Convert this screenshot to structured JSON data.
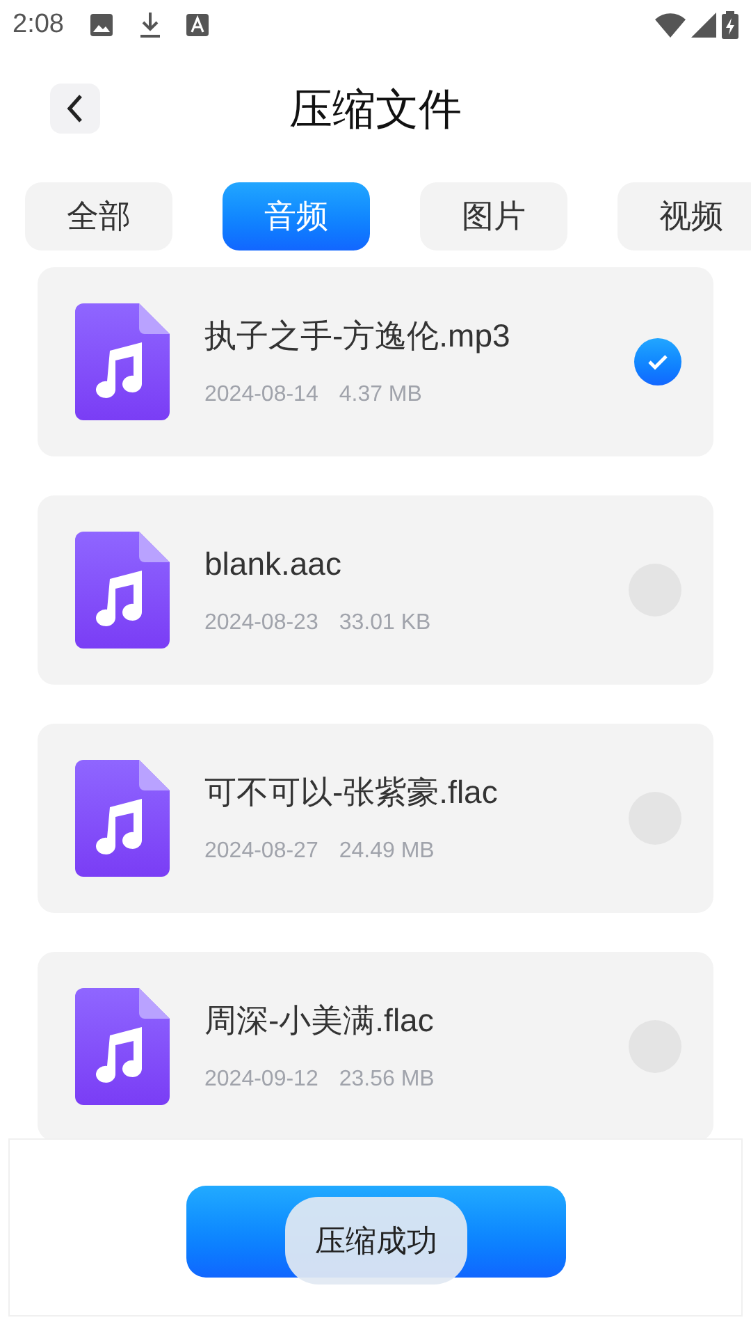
{
  "status_bar": {
    "time": "2:08"
  },
  "header": {
    "title": "压缩文件"
  },
  "tabs": [
    {
      "label": "全部",
      "selected": false
    },
    {
      "label": "音频",
      "selected": true
    },
    {
      "label": "图片",
      "selected": false
    },
    {
      "label": "视频",
      "selected": false
    }
  ],
  "files": [
    {
      "name": "执子之手-方逸伦.mp3",
      "date": "2024-08-14",
      "size": "4.37 MB",
      "selected": true
    },
    {
      "name": "blank.aac",
      "date": "2024-08-23",
      "size": "33.01 KB",
      "selected": false
    },
    {
      "name": "可不可以-张紫豪.flac",
      "date": "2024-08-27",
      "size": "24.49 MB",
      "selected": false
    },
    {
      "name": "周深-小美满.flac",
      "date": "2024-09-12",
      "size": "23.56 MB",
      "selected": false
    }
  ],
  "toast": {
    "message": "压缩成功"
  }
}
